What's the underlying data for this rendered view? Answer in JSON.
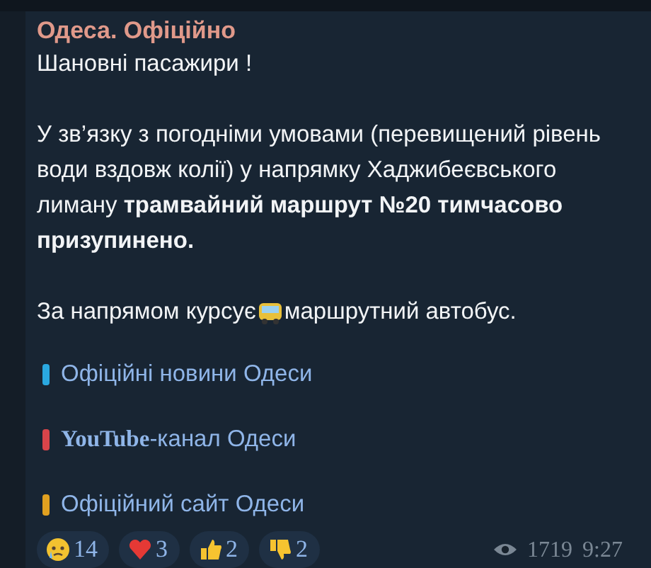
{
  "channel": {
    "title": "Одеса. Офіційно"
  },
  "message": {
    "paragraphs": [
      {
        "kind": "text",
        "text": "Шановні пасажири !"
      },
      {
        "kind": "text",
        "text": "У зв’язку з погодніми умовами (перевищений рівень води вздовж колії) у напрямку Хаджибеєвського лиману **трамвайний маршрут №20 тимчасово призупинено.**"
      },
      {
        "kind": "bus",
        "before": "За напрямом курсує ",
        "after": "маршрутний автобус."
      }
    ],
    "links": [
      {
        "text": "Офіційні новини Одеси",
        "color": "#2aa8e0"
      },
      {
        "text": "**YouTube**-канал Одеси",
        "color": "#d8444a"
      },
      {
        "text": "Офіційний сайт Одеси",
        "color": "#e0a020"
      }
    ]
  },
  "reactions": [
    {
      "kind": "crying",
      "count": "14"
    },
    {
      "kind": "heart",
      "count": "3"
    },
    {
      "kind": "thumbs-up",
      "count": "2"
    },
    {
      "kind": "thumbs-down",
      "count": "2"
    }
  ],
  "views": "1719",
  "time": "9:27"
}
